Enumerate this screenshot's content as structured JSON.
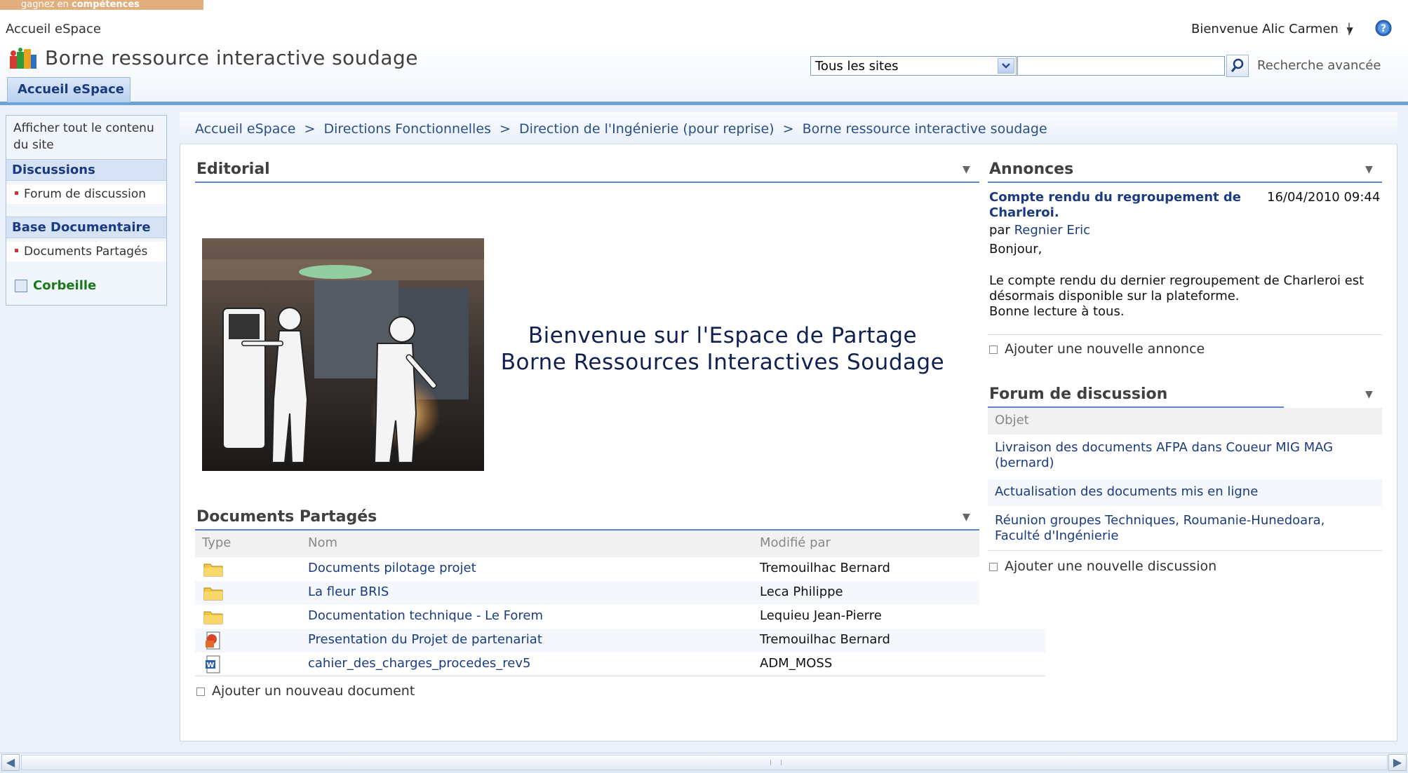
{
  "banner": {
    "prefix": "gagnez en ",
    "bold": "compétences"
  },
  "global": {
    "home_link": "Accueil eSpace",
    "welcome_user": "Bienvenue Alic Carmen",
    "separator": "|"
  },
  "site": {
    "title": "Borne ressource interactive soudage"
  },
  "tabs": [
    {
      "label": "Accueil eSpace"
    }
  ],
  "search": {
    "scope": "Tous les sites",
    "query": "",
    "advanced": "Recherche avancée"
  },
  "quicklaunch": {
    "view_all": "Afficher tout le contenu du site",
    "sections": [
      {
        "header": "Discussions",
        "items": [
          "Forum de discussion"
        ]
      },
      {
        "header": "Base Documentaire",
        "items": [
          "Documents Partagés"
        ]
      }
    ],
    "recycle": "Corbeille"
  },
  "breadcrumb": [
    "Accueil eSpace",
    "Directions Fonctionnelles",
    "Direction de l'Ingénierie (pour reprise)",
    "Borne ressource interactive soudage"
  ],
  "breadcrumb_sep": ">",
  "editorial": {
    "title": "Editorial",
    "welcome_line1": "Bienvenue sur l'Espace de Partage",
    "welcome_line2": "Borne Ressources Interactives Soudage"
  },
  "documents": {
    "title": "Documents Partagés",
    "columns": [
      "Type",
      "Nom",
      "Modifié par"
    ],
    "rows": [
      {
        "type": "folder-icon",
        "name": "Documents pilotage projet",
        "modified_by": "Tremouilhac Bernard"
      },
      {
        "type": "folder-icon",
        "name": "La fleur BRIS",
        "modified_by": "Leca Philippe"
      },
      {
        "type": "folder-icon",
        "name": "Documentation technique - Le Forem",
        "modified_by": "Lequieu Jean-Pierre"
      },
      {
        "type": "powerpoint-icon",
        "name": "Presentation du Projet de partenariat",
        "modified_by": "Tremouilhac Bernard"
      },
      {
        "type": "word-icon",
        "name": "cahier_des_charges_procedes_rev5",
        "modified_by": "ADM_MOSS"
      }
    ],
    "add": "Ajouter un nouveau document"
  },
  "announcements": {
    "title": "Annonces",
    "item": {
      "title": "Compte rendu du regroupement de Charleroi.",
      "date": "16/04/2010 09:44",
      "by_prefix": "par",
      "author": "Regnier Eric",
      "greeting": "Bonjour,",
      "body1": "Le compte rendu du dernier regroupement de Charleroi est",
      "body2": "désormais disponible sur la plateforme.",
      "body3": "Bonne lecture à tous."
    },
    "add": "Ajouter une nouvelle annonce"
  },
  "forum": {
    "title": "Forum de discussion",
    "column": "Objet",
    "rows": [
      "Livraison des documents AFPA dans Coueur MIG MAG (bernard)",
      "Actualisation des documents mis en ligne",
      "Réunion groupes Techniques, Roumanie-Hunedoara, Faculté d'Ingénierie"
    ],
    "add": "Ajouter une nouvelle discussion"
  },
  "colors": {
    "accent": "#1b3b80",
    "tab_bar": "#6fa0d8",
    "recycle": "#1a7a1a"
  }
}
